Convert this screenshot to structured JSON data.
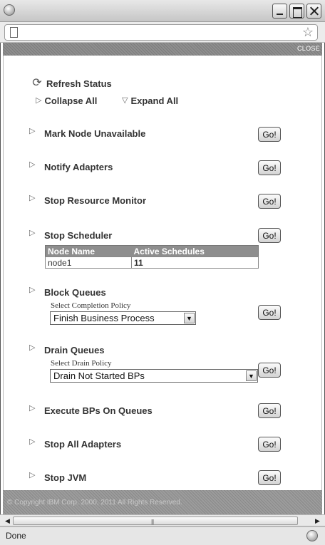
{
  "window": {
    "close_link": "CLOSE"
  },
  "toolbar": {
    "refresh_label": "Refresh Status",
    "collapse_label": "Collapse All",
    "expand_label": "Expand All"
  },
  "go_label": "Go!",
  "actions": {
    "mark_node": "Mark Node Unavailable",
    "notify_adapters": "Notify Adapters",
    "stop_resource_monitor": "Stop Resource Monitor",
    "stop_scheduler": "Stop Scheduler",
    "block_queues": "Block Queues",
    "drain_queues": "Drain Queues",
    "execute_bps": "Execute BPs On Queues",
    "stop_all_adapters": "Stop All Adapters",
    "stop_jvm": "Stop JVM"
  },
  "scheduler_table": {
    "headers": [
      "Node Name",
      "Active Schedules"
    ],
    "rows": [
      [
        "node1",
        "11"
      ]
    ]
  },
  "block_queues": {
    "select_label": "Select Completion Policy",
    "selected": "Finish Business Process"
  },
  "drain_queues": {
    "select_label": "Select Drain Policy",
    "selected": "Drain Not Started BPs"
  },
  "footer": {
    "copyright": "© Copyright IBM Corp. 2000, 2011 All Rights Reserved."
  },
  "statusbar": {
    "text": "Done"
  }
}
